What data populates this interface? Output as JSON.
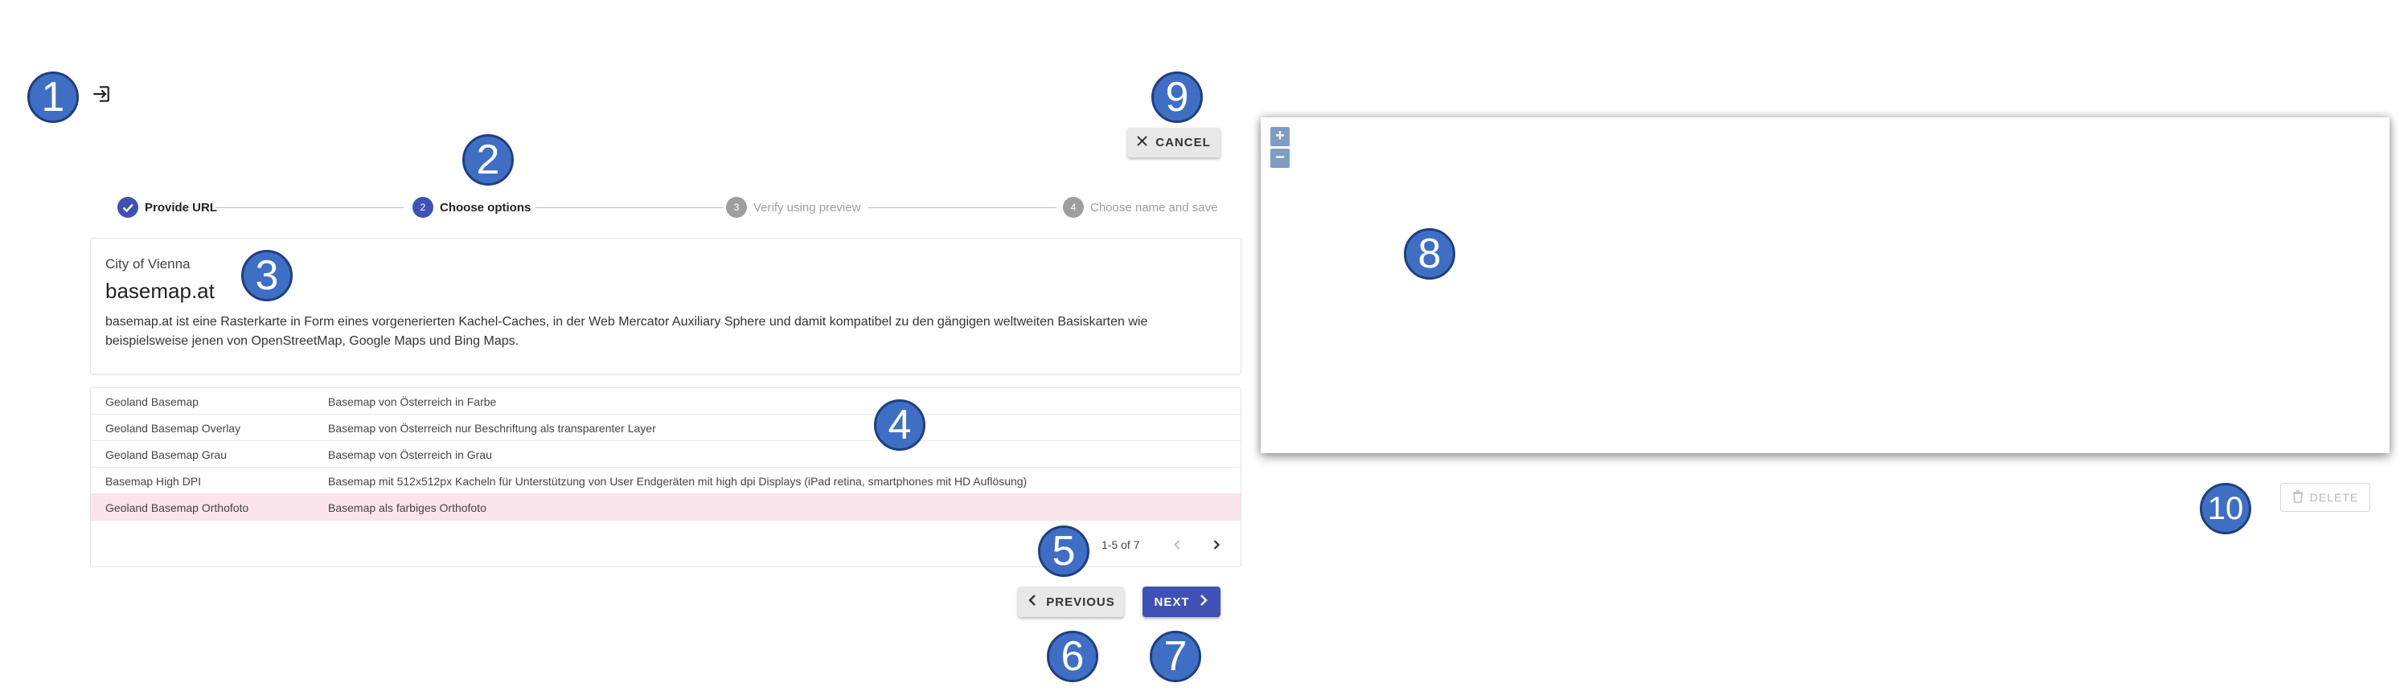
{
  "header": {
    "login_icon": "login-icon"
  },
  "buttons": {
    "cancel": "CANCEL",
    "previous": "PREVIOUS",
    "next": "NEXT",
    "delete": "DELETE"
  },
  "stepper": {
    "steps": [
      {
        "label": "Provide URL",
        "state": "done"
      },
      {
        "label": "Choose options",
        "number": "2",
        "state": "active"
      },
      {
        "label": "Verify using preview",
        "number": "3",
        "state": "inactive"
      },
      {
        "label": "Choose name and save",
        "number": "4",
        "state": "inactive"
      }
    ]
  },
  "service": {
    "organization": "City of Vienna",
    "title": "basemap.at",
    "description": "basemap.at ist eine Rasterkarte in Form eines vorgenerierten Kachel-Caches, in der Web Mercator Auxiliary Sphere und damit kompatibel zu den gängigen weltweiten Basiskarten wie beispielsweise jenen von OpenStreetMap, Google Maps und Bing Maps."
  },
  "layers": {
    "rows": [
      {
        "name": "Geoland Basemap",
        "description": "Basemap von Österreich in Farbe"
      },
      {
        "name": "Geoland Basemap Overlay",
        "description": "Basemap von Österreich nur Beschriftung als transparenter Layer"
      },
      {
        "name": "Geoland Basemap Grau",
        "description": "Basemap von Österreich in Grau"
      },
      {
        "name": "Basemap High DPI",
        "description": "Basemap mit 512x512px Kacheln für Unterstützung von User Endgeräten mit high dpi Displays (iPad retina, smartphones mit HD Auflösung)"
      },
      {
        "name": "Geoland Basemap Orthofoto",
        "description": "Basemap als farbiges Orthofoto",
        "selected": true
      }
    ],
    "pagination": "1-5 of 7"
  },
  "map": {
    "zoom_in": "+",
    "zoom_out": "−"
  },
  "annotations": [
    "1",
    "2",
    "3",
    "4",
    "5",
    "6",
    "7",
    "8",
    "9",
    "10"
  ],
  "colors": {
    "primary": "#3f51b5",
    "badge": "#3f6fc4",
    "selected_row": "#fce4ec",
    "inactive_step": "#9e9e9e"
  }
}
